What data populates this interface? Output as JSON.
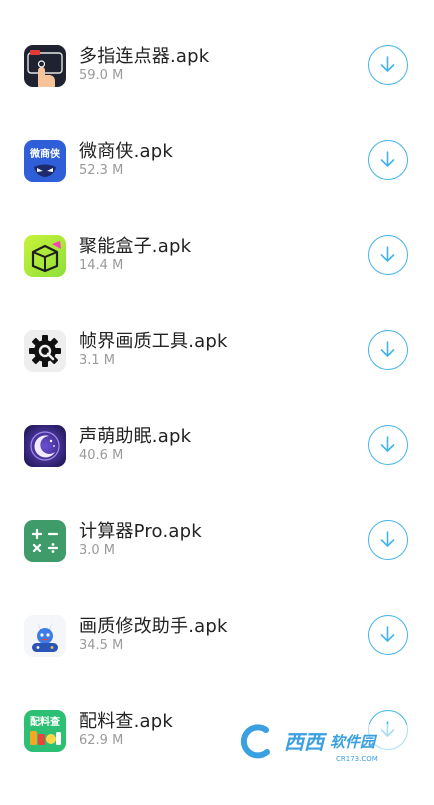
{
  "colors": {
    "accent": "#43b4ea",
    "name": "#222222",
    "size": "#9a9a9a"
  },
  "apps": [
    {
      "name": "多指连点器.apk",
      "size": "59.0 M",
      "icon": "multi-finger-clicker-icon",
      "button": "download-icon"
    },
    {
      "name": "微商侠.apk",
      "size": "52.3 M",
      "icon": "weishangxia-icon",
      "button": "download-icon"
    },
    {
      "name": "聚能盒子.apk",
      "size": "14.4 M",
      "icon": "juneng-box-icon",
      "button": "download-icon"
    },
    {
      "name": "帧界画质工具.apk",
      "size": "3.1 M",
      "icon": "gear-icon",
      "button": "download-icon"
    },
    {
      "name": "声萌助眠.apk",
      "size": "40.6 M",
      "icon": "moon-sleep-icon",
      "button": "download-icon"
    },
    {
      "name": "计算器Pro.apk",
      "size": "3.0 M",
      "icon": "calculator-icon",
      "button": "download-icon"
    },
    {
      "name": "画质修改助手.apk",
      "size": "34.5 M",
      "icon": "gamer-mascot-icon",
      "button": "download-icon"
    },
    {
      "name": "配料查.apk",
      "size": "62.9 M",
      "icon": "ingredients-check-icon",
      "button": "download-icon"
    }
  ],
  "icon_text": {
    "weishangxia": "微商侠",
    "peiliaocha": "配料查"
  },
  "watermark": {
    "brand": "西西",
    "sub": "软件园",
    "url": "CR173.COM"
  }
}
